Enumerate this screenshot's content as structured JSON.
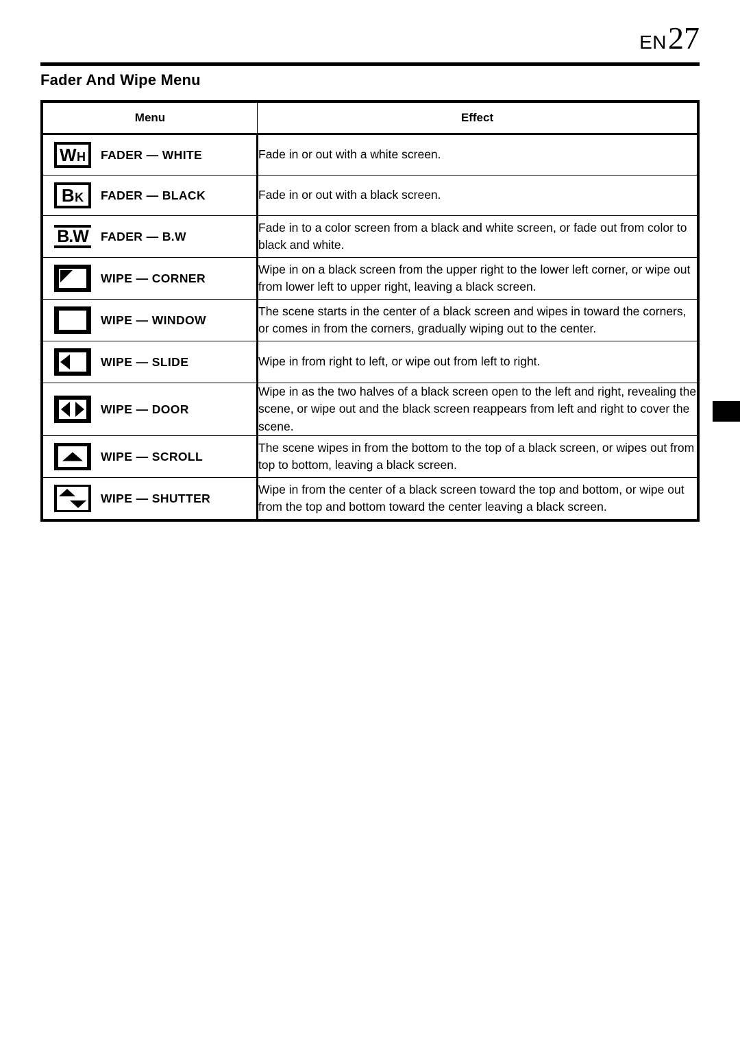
{
  "header": {
    "language_code": "EN",
    "page_number": "27"
  },
  "section": {
    "title": "Fader And Wipe Menu"
  },
  "table": {
    "columns": [
      "Menu",
      "Effect"
    ],
    "rows": [
      {
        "icon": "wh-letterbox-icon",
        "icon_text_big": "W",
        "icon_text_small": "H",
        "menu": "FADER — WHITE",
        "effect": "Fade in or out with a white screen."
      },
      {
        "icon": "bk-letterbox-icon",
        "icon_text_big": "B",
        "icon_text_small": "K",
        "menu": "FADER — BLACK",
        "effect": "Fade in or out with a black screen."
      },
      {
        "icon": "bw-barred-icon",
        "icon_text_big": "B.W",
        "icon_text_small": "",
        "menu": "FADER — B.W",
        "effect": "Fade in to a color screen from a black and white screen, or fade out from color to black and white."
      },
      {
        "icon": "wipe-corner-icon",
        "icon_text_big": "",
        "icon_text_small": "",
        "menu": "WIPE — CORNER",
        "effect": "Wipe in on a black screen from the upper right to the lower left corner, or wipe out from lower left to upper right, leaving a black screen."
      },
      {
        "icon": "wipe-window-icon",
        "icon_text_big": "",
        "icon_text_small": "",
        "menu": "WIPE — WINDOW",
        "effect": "The scene starts in the center of a black screen and wipes in toward the corners, or comes in from the corners, gradually wiping out to the center."
      },
      {
        "icon": "wipe-slide-icon",
        "icon_text_big": "",
        "icon_text_small": "",
        "menu": "WIPE — SLIDE",
        "effect": "Wipe in from right to left, or wipe out from left to right."
      },
      {
        "icon": "wipe-door-icon",
        "icon_text_big": "",
        "icon_text_small": "",
        "menu": "WIPE — DOOR",
        "effect": "Wipe in as the two halves of a black screen open to the left and right, revealing the scene, or wipe out and the black screen reappears from left and right to cover the scene."
      },
      {
        "icon": "wipe-scroll-icon",
        "icon_text_big": "",
        "icon_text_small": "",
        "menu": "WIPE — SCROLL",
        "effect": "The scene wipes in from the bottom to the top of a black screen, or wipes out from top to bottom, leaving a black screen."
      },
      {
        "icon": "wipe-shutter-icon",
        "icon_text_big": "",
        "icon_text_small": "",
        "menu": "WIPE — SHUTTER",
        "effect": "Wipe in from the center of a black screen toward the top and bottom, or wipe out from the top and bottom toward the center leaving a black screen."
      }
    ]
  }
}
